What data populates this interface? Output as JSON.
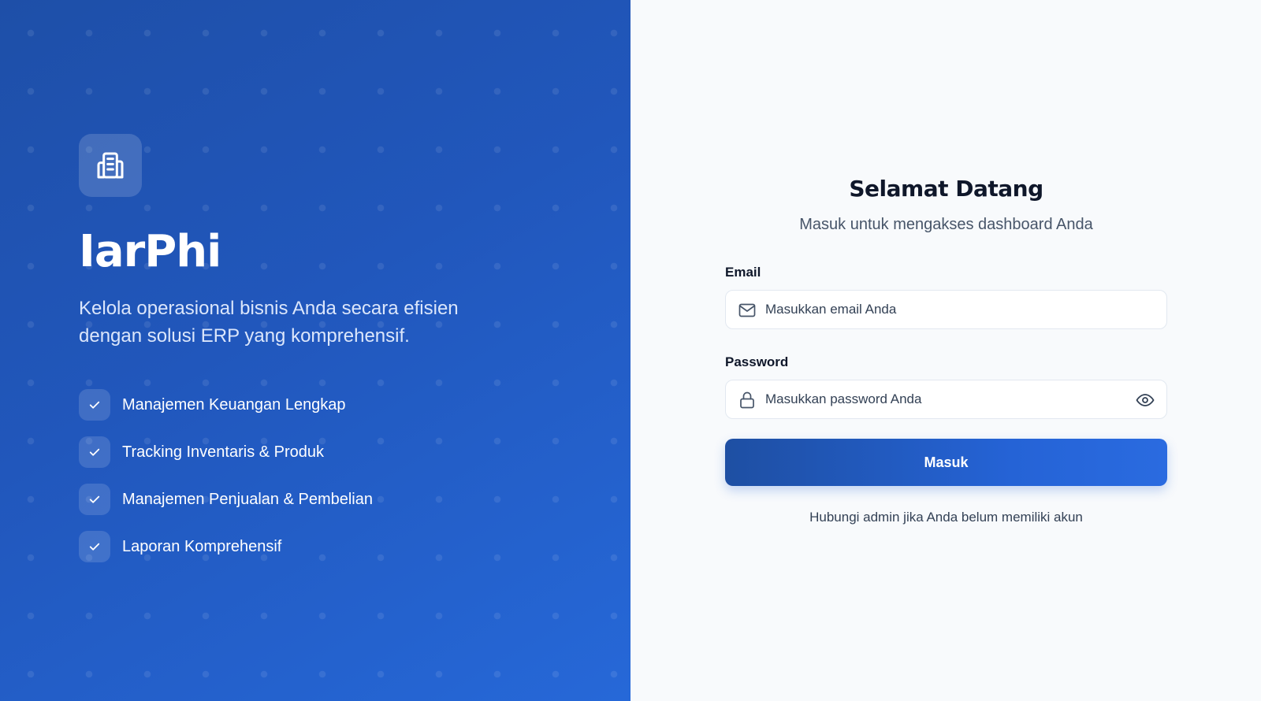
{
  "brand": {
    "name": "IarPhi",
    "tagline": "Kelola operasional bisnis Anda secara efisien dengan solusi ERP yang komprehensif.",
    "logo_icon": "building-document-icon"
  },
  "features": [
    {
      "label": "Manajemen Keuangan Lengkap",
      "icon": "check-icon"
    },
    {
      "label": "Tracking Inventaris & Produk",
      "icon": "check-icon"
    },
    {
      "label": "Manajemen Penjualan & Pembelian",
      "icon": "check-icon"
    },
    {
      "label": "Laporan Komprehensif",
      "icon": "check-icon"
    }
  ],
  "login": {
    "title": "Selamat Datang",
    "subtitle": "Masuk untuk mengakses dashboard Anda",
    "email": {
      "label": "Email",
      "placeholder": "Masukkan email Anda",
      "value": "",
      "icon": "mail-icon"
    },
    "password": {
      "label": "Password",
      "placeholder": "Masukkan password Anda",
      "value": "",
      "icon": "lock-icon",
      "toggle_icon": "eye-icon"
    },
    "submit_label": "Masuk",
    "footnote": "Hubungi admin jika Anda belum memiliki akun"
  },
  "colors": {
    "hero_gradient_start": "#1e4fa8",
    "hero_gradient_end": "#2668d8",
    "button_primary": "#2563d6",
    "panel_background": "#f8fafc",
    "heading_text": "#0f172a"
  }
}
